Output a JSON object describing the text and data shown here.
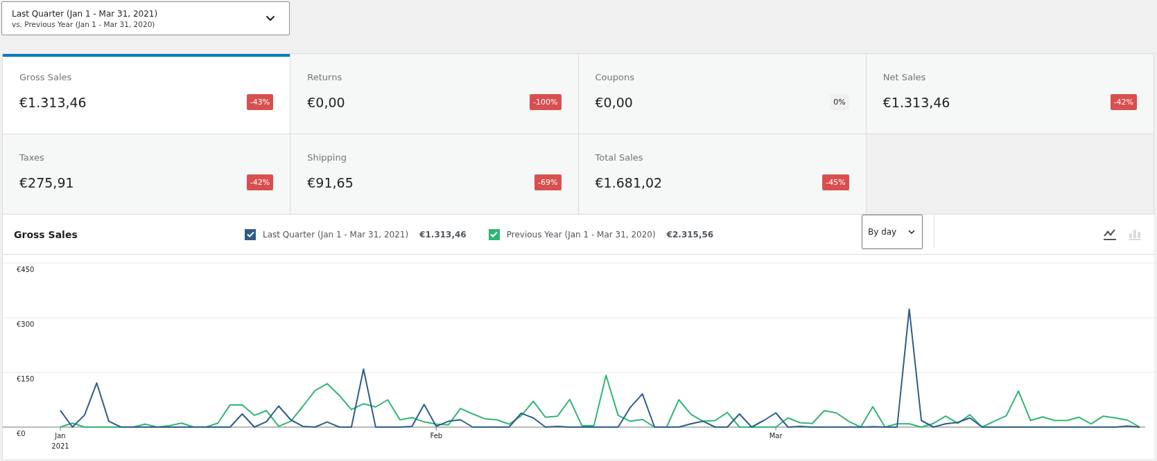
{
  "date_range": {
    "primary": "Last Quarter (Jan 1 - Mar 31, 2021)",
    "secondary": "vs. Previous Year (Jan 1 - Mar 31, 2020)"
  },
  "stats": [
    {
      "label": "Gross Sales",
      "value": "€1.313,46",
      "delta": "-43%",
      "kind": "negative",
      "selected": true
    },
    {
      "label": "Returns",
      "value": "€0,00",
      "delta": "-100%",
      "kind": "negative",
      "selected": false
    },
    {
      "label": "Coupons",
      "value": "€0,00",
      "delta": "0%",
      "kind": "neutral",
      "selected": false
    },
    {
      "label": "Net Sales",
      "value": "€1.313,46",
      "delta": "-42%",
      "kind": "negative",
      "selected": false
    },
    {
      "label": "Taxes",
      "value": "€275,91",
      "delta": "-42%",
      "kind": "negative",
      "selected": false
    },
    {
      "label": "Shipping",
      "value": "€91,65",
      "delta": "-69%",
      "kind": "negative",
      "selected": false
    },
    {
      "label": "Total Sales",
      "value": "€1.681,02",
      "delta": "-45%",
      "kind": "negative",
      "selected": false
    }
  ],
  "chart_panel": {
    "title": "Gross Sales",
    "legend": [
      {
        "total": "€1.313,46",
        "checked": true
      },
      {
        "total": "€2.315,56",
        "checked": true
      }
    ],
    "interval": {
      "value": "By day"
    },
    "chart_types": [
      {
        "kind": "line",
        "selected": true
      },
      {
        "kind": "bar",
        "selected": false
      }
    ],
    "year_label": "2021",
    "chart_data": {
      "type": "line",
      "categories": [
        "Jan",
        null,
        null,
        null,
        null,
        null,
        null,
        null,
        null,
        null,
        null,
        null,
        null,
        null,
        null,
        null,
        null,
        null,
        null,
        null,
        null,
        null,
        null,
        null,
        null,
        null,
        null,
        null,
        null,
        null,
        null,
        "Feb",
        null,
        null,
        null,
        null,
        null,
        null,
        null,
        null,
        null,
        null,
        null,
        null,
        null,
        null,
        null,
        null,
        null,
        null,
        null,
        null,
        null,
        null,
        null,
        null,
        null,
        null,
        null,
        "Mar",
        null,
        null,
        null,
        null,
        null,
        null,
        null,
        null,
        null,
        null,
        null,
        null,
        null,
        null,
        null,
        null,
        null,
        null,
        null,
        null,
        null,
        null,
        null,
        null,
        null,
        null,
        null,
        null,
        null,
        null
      ],
      "ylim": [
        0,
        450
      ],
      "yticks": [
        {
          "value": 0,
          "label": "€0"
        },
        {
          "value": 150,
          "label": "€150"
        },
        {
          "value": 300,
          "label": "€300"
        },
        {
          "value": 450,
          "label": "€450"
        }
      ],
      "series": [
        {
          "name": "Last Quarter (Jan 1 - Mar 31, 2021)",
          "color": "#2e5d87",
          "values": [
            46,
            0,
            33,
            121,
            16,
            0,
            0,
            0,
            0,
            0,
            0,
            0,
            0,
            0,
            0,
            36,
            0,
            15,
            58,
            20,
            2,
            0,
            14,
            0,
            0,
            159,
            0,
            0,
            0,
            2,
            62,
            2,
            16,
            20,
            0,
            0,
            0,
            0,
            38,
            25,
            0,
            2,
            0,
            0,
            0,
            0,
            0,
            54,
            91,
            0,
            0,
            0,
            9,
            16,
            0,
            0,
            36,
            0,
            18,
            39,
            0,
            2,
            0,
            0,
            0,
            0,
            0,
            1,
            0,
            0,
            324,
            18,
            0,
            9,
            13,
            25,
            0,
            0,
            0,
            0,
            0,
            0,
            0,
            0,
            0,
            0,
            0,
            0,
            3,
            0
          ]
        },
        {
          "name": "Previous Year (Jan 1 - Mar 31, 2020)",
          "color": "#30b674",
          "values": [
            0,
            11,
            0,
            0,
            0,
            0,
            0,
            8,
            0,
            4,
            11,
            0,
            0,
            11,
            61,
            61,
            32,
            45,
            2,
            16,
            57,
            100,
            119,
            87,
            48,
            64,
            55,
            75,
            20,
            26,
            14,
            8,
            6,
            51,
            36,
            23,
            20,
            8,
            31,
            71,
            27,
            30,
            76,
            4,
            4,
            142,
            32,
            16,
            21,
            0,
            0,
            75,
            35,
            16,
            18,
            40,
            0,
            0,
            0,
            0,
            25,
            12,
            10,
            45,
            39,
            16,
            0,
            56,
            0,
            9,
            9,
            0,
            10,
            30,
            10,
            34,
            0,
            16,
            31,
            99,
            18,
            28,
            18,
            18,
            27,
            9,
            30,
            25,
            19,
            0
          ]
        }
      ]
    }
  }
}
